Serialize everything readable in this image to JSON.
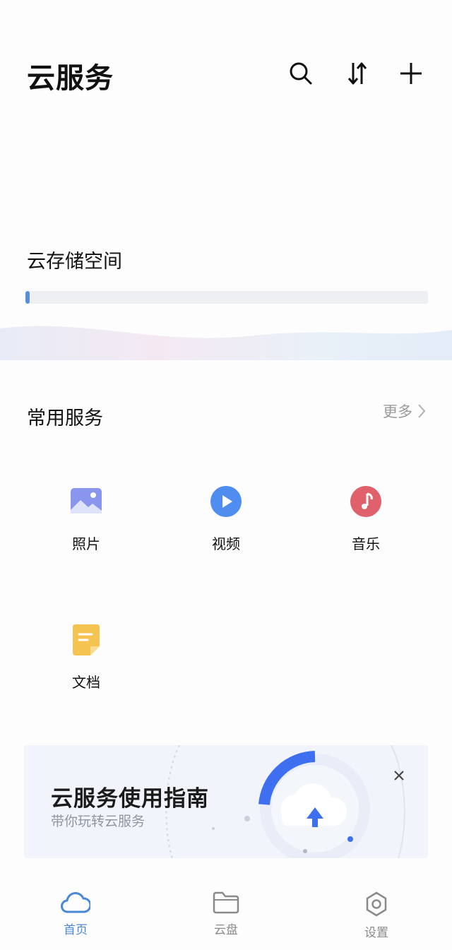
{
  "app": {
    "title": "云服务"
  },
  "header": {
    "icons": [
      "search-icon",
      "sort-icon",
      "add-icon"
    ]
  },
  "storage": {
    "title": "云存储空间",
    "used_fraction": 0.01,
    "fill_color": "#5a8fd8"
  },
  "services": {
    "title": "常用服务",
    "more_label": "更多",
    "items": [
      {
        "label": "照片",
        "icon": "photo-icon",
        "color": "#7b86e8"
      },
      {
        "label": "视频",
        "icon": "video-play-icon",
        "color": "#4f8df0"
      },
      {
        "label": "音乐",
        "icon": "music-icon",
        "color": "#e0616b"
      },
      {
        "label": "文档",
        "icon": "document-icon",
        "color": "#f4c04f"
      }
    ]
  },
  "guide": {
    "title": "云服务使用指南",
    "subtitle": "带你玩转云服务",
    "accent": "#3e6ff0"
  },
  "bottom_nav": {
    "active_color": "#4a87d6",
    "inactive_color": "#8a8a8a",
    "items": [
      {
        "label": "首页",
        "icon": "cloud-icon",
        "active": true
      },
      {
        "label": "云盘",
        "icon": "folder-icon",
        "active": false
      },
      {
        "label": "设置",
        "icon": "gear-icon",
        "active": false
      }
    ]
  }
}
